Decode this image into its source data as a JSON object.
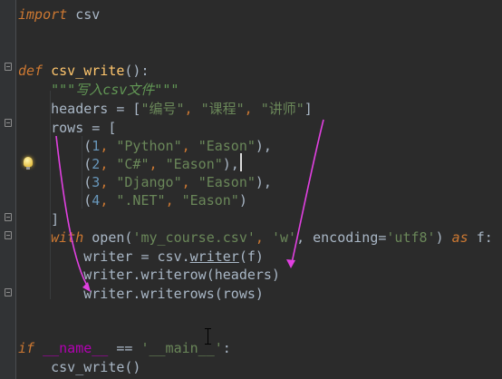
{
  "editor": {
    "colors": {
      "background": "#2b2b2b",
      "keyword": "#cc7832",
      "function": "#ffc66d",
      "string": "#6a8759",
      "number": "#6897bb",
      "annotation_arrow": "#e040e0"
    },
    "lines": {
      "l1": {
        "kw": "import",
        "rest": " csv"
      },
      "l4": {
        "kw": "def",
        "sp": " ",
        "fn": "csv_write",
        "rest": "():"
      },
      "l5": {
        "indent": "    ",
        "doc": "\"\"\"写入csv文件\"\"\""
      },
      "l6": {
        "indent": "    ",
        "var": "headers = [",
        "s1": "\"编号\"",
        "c1": ", ",
        "s2": "\"课程\"",
        "c2": ", ",
        "s3": "\"讲师\"",
        "end": "]"
      },
      "l7": {
        "indent": "    ",
        "text": "rows = ["
      },
      "l8": {
        "indent": "        ",
        "open": "(",
        "n": "1",
        "c1": ", ",
        "s1": "\"Python\"",
        "c2": ", ",
        "s2": "\"Eason\"",
        "end": "),"
      },
      "l9": {
        "indent": "        ",
        "open": "(",
        "n": "2",
        "c1": ", ",
        "s1": "\"C#\"",
        "c2": ", ",
        "s2": "\"Eason\"",
        "end": "),"
      },
      "l10": {
        "indent": "        ",
        "open": "(",
        "n": "3",
        "c1": ", ",
        "s1": "\"Django\"",
        "c2": ", ",
        "s2": "\"Eason\"",
        "end": "),"
      },
      "l11": {
        "indent": "        ",
        "open": "(",
        "n": "4",
        "c1": ", ",
        "s1": "\".NET\"",
        "c2": ", ",
        "s2": "\"Eason\"",
        "end": ")"
      },
      "l12": {
        "indent": "    ",
        "text": "]"
      },
      "l13": {
        "indent": "    ",
        "kw": "with",
        "p1": " open(",
        "s1": "'my_course.csv'",
        "p2": ", ",
        "s2": "'w'",
        "p3": ", encoding=",
        "s3": "'utf8'",
        "p4": ") ",
        "kw2": "as",
        "p5": " f:"
      },
      "l14": {
        "indent": "        ",
        "p1": "writer = csv.",
        "u": "writer",
        "p2": "(f)"
      },
      "l15": {
        "indent": "        ",
        "text": "writer.writerow(headers)"
      },
      "l16": {
        "indent": "        ",
        "text": "writer.writerows(rows)"
      },
      "l19": {
        "kw": "if",
        "sp": " ",
        "magic": "__name__",
        "op": " == ",
        "s1": "'__main__'",
        "end": ":"
      },
      "l20": {
        "indent": "    ",
        "text": "csv_write()"
      }
    }
  }
}
